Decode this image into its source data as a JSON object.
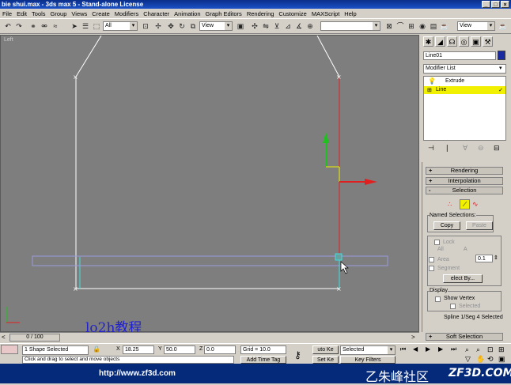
{
  "window": {
    "title": "bie shui.max - 3ds max 5 - Stand-alone License"
  },
  "menu": [
    "File",
    "Edit",
    "Tools",
    "Group",
    "Views",
    "Create",
    "Modifiers",
    "Character",
    "Animation",
    "Graph Editors",
    "Rendering",
    "Customize",
    "MAXScript",
    "Help"
  ],
  "toolbar": {
    "selection_filter": "All",
    "ref_coord": "View",
    "named_sel": "",
    "view_right": "View"
  },
  "viewport": {
    "label": "Left",
    "watermark": "lo2h教程"
  },
  "timeline": {
    "slider": "0 / 100"
  },
  "command_panel": {
    "object_name": "Line01",
    "modifier_list": "Modifier List",
    "stack": [
      "Extrude",
      "Line"
    ],
    "rollouts": {
      "rendering": "Rendering",
      "interpolation": "Interpolation",
      "selection": "Selection",
      "soft_selection": "Soft Selection"
    },
    "signs": {
      "plus": "+",
      "minus": "-"
    },
    "named_selections": "Named Selections:",
    "copy": "Copy",
    "paste": "Paste",
    "lock": "Lock",
    "all": "All",
    "a": "A",
    "value": "0.1",
    "area": "Area",
    "segment": "Segment",
    "select_by": "elect By...",
    "display": "Display",
    "show_vertex": "Show Vertex",
    "selected": "Selected",
    "status_line": "Spline 1/Seg 4 Selected"
  },
  "status": {
    "selection": "1 Shape Selected",
    "x_label": "X",
    "x": "18.25",
    "y_label": "Y",
    "y": "50.0",
    "z_label": "Z",
    "z": "0.0",
    "grid": "Grid = 10.0",
    "prompt": "Click and drag to select and move objects",
    "auto_key": "uto Ke",
    "set_key": "Set Ke",
    "key_mode": "Selected",
    "key_filters": "Key Filters",
    "add_time_tag": "Add Time Tag"
  },
  "banner": {
    "url": "http://www.zf3d.com",
    "site_cn": "乙朱峰社区",
    "site_domain": "ZF3D.COM"
  },
  "colors": {
    "accent_yellow": "#f0f000",
    "title_blue": "#0a2e8a",
    "spline_red": "#e02020"
  }
}
